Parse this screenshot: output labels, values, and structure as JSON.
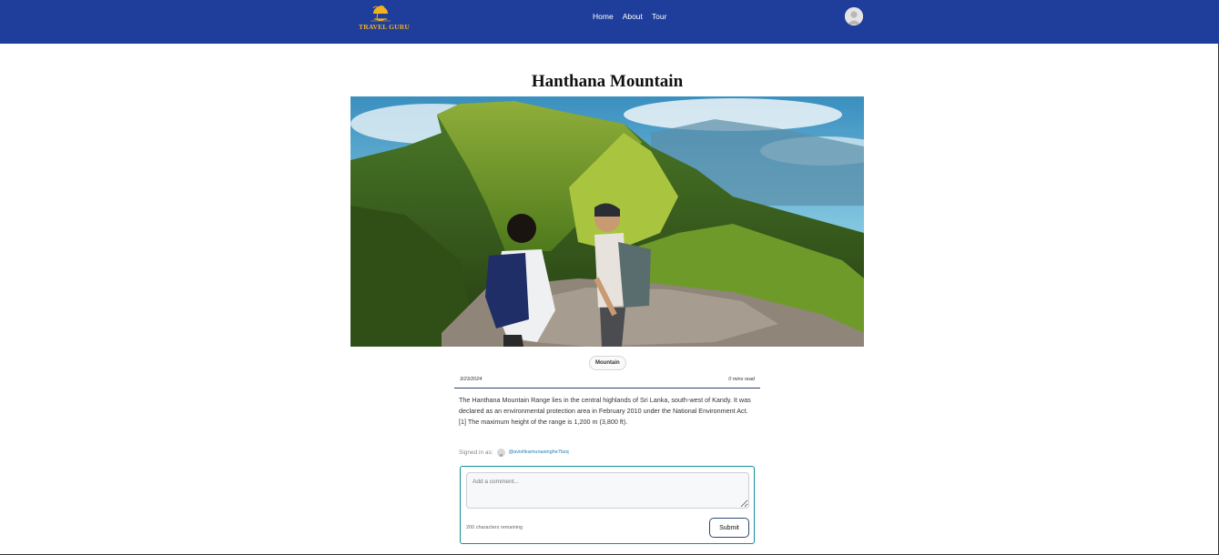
{
  "header": {
    "logo_text": "TRAVEL GURU",
    "nav": [
      "Home",
      "About",
      "Tour"
    ],
    "colors": {
      "bar": "#1f3e9c",
      "logo": "#f2b21c"
    }
  },
  "post": {
    "title": "Hanthana Mountain",
    "category": "Mountain",
    "date": "3/23/2024",
    "read_time": "0 mins read",
    "content": "The Hanthana Mountain Range lies in the central highlands of Sri Lanka, south-west of Kandy. It was declared as an environmental protection area in February 2010 under the National Environment Act.[1] The maximum height of the range is 1,200 m (3,800 ft)."
  },
  "comments": {
    "signed_in_label": "Signed in as:",
    "username": "@avishkamunasinghe7bzq",
    "placeholder": "Add a comment...",
    "remaining": "200 characters remaining",
    "submit_label": "Submit"
  }
}
